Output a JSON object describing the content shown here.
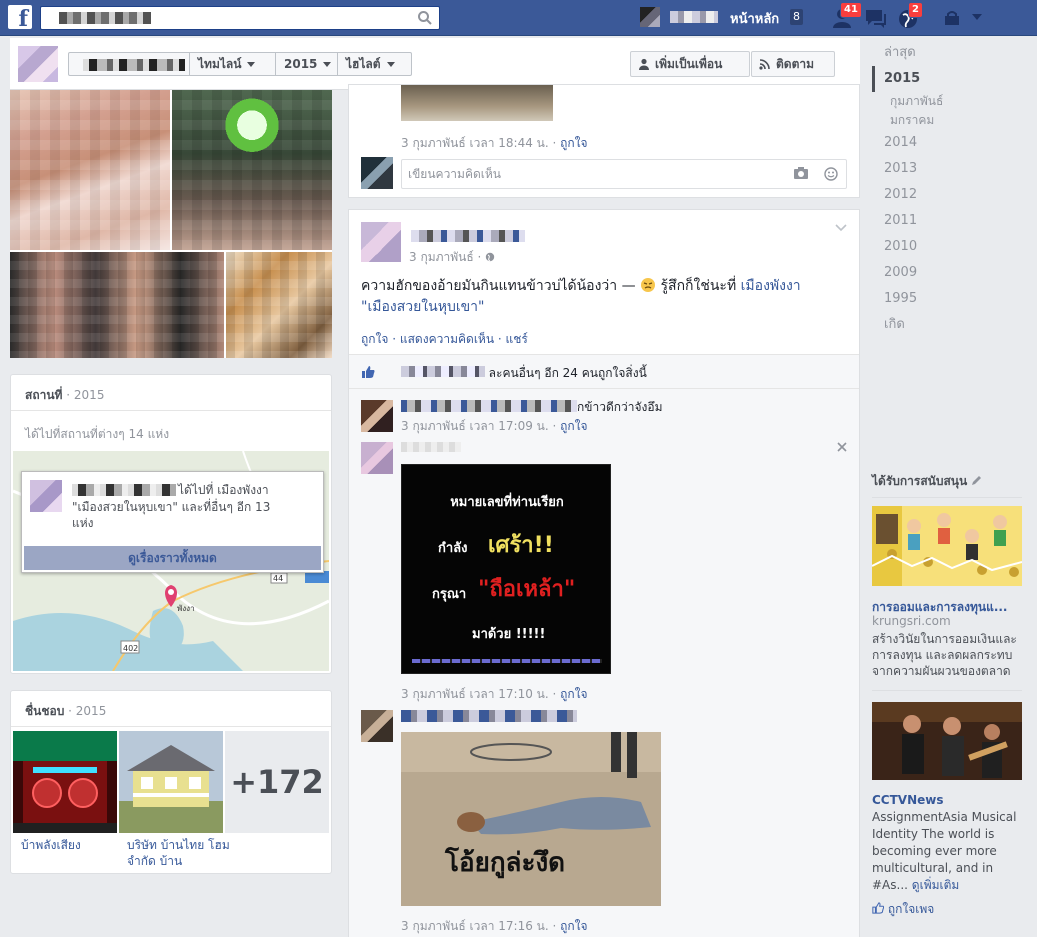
{
  "topbar": {
    "home_label": "หน้าหลัก",
    "home_count": "8",
    "friend_requests_count": "41",
    "notifications_count": "2"
  },
  "timeline_nav": {
    "timeline_label": "ไทมไลน์",
    "year_label": "2015",
    "highlights_label": "ไฮไลต์",
    "add_friend_label": "เพิ่มเป็นเพื่อน",
    "follow_label": "ติดตาม"
  },
  "places": {
    "title": "สถานที่",
    "year": "· 2015",
    "count_text": "ได้ไปที่สถานที่ต่างๆ 14 แห่ง",
    "popup_text_1": "ได้ไปที่ เมืองพังงา",
    "popup_text_2": "\"เมืองสวยในหุบเขา\" และที่อื่นๆ อีก 13",
    "popup_text_3": "แห่ง",
    "popup_button": "ดูเรื่องราวทั้งหมด",
    "map_road_1": "402",
    "map_road_2": "44",
    "map_city": "พังงา"
  },
  "likes": {
    "title": "ชื่นชอบ",
    "year": "· 2015",
    "items": [
      {
        "label": "บ้าพลังเสียง"
      },
      {
        "label": "บริษัท บ้านไทย โฮม จำกัด บ้าน"
      }
    ],
    "more_count": "+172"
  },
  "post1": {
    "time": "3 กุมภาพันธ์ เวลา 18:44 น.",
    "like": "ถูกใจ",
    "comment_placeholder": "เขียนความคิดเห็น"
  },
  "post2": {
    "date": "3 กุมภาพันธ์",
    "text_1": "ความฮักของอ้ายมันกินแทนข้าวบ่ได้น้องว่า —",
    "feeling": "รู้สึกก็ใช่นะที่",
    "place": "เมืองพังงา",
    "text_2": "\"เมืองสวยในหุบเขา\"",
    "action_like": "ถูกใจ",
    "action_comment": "แสดงความคิดเห็น",
    "action_share": "แชร์",
    "likes_text": "ละคนอื่นๆ อีก 24 คนถูกใจสิ่งนี้",
    "comments": [
      {
        "text": "กข้าวดีกว่าจังอึม",
        "time": "3 กุมภาพันธ์ เวลา 17:09 น.",
        "like": "ถูกใจ"
      },
      {
        "time": "3 กุมภาพันธ์ เวลา 17:10 น.",
        "like": "ถูกใจ"
      },
      {
        "time": "3 กุมภาพันธ์ เวลา 17:16 น.",
        "like": "ถูกใจ"
      }
    ],
    "image1": {
      "line1": "หมายเลขที่ท่านเรียก",
      "line2a": "กำลัง",
      "line2b": "เศร้า!!",
      "line3a": "กรุณา",
      "line3b": "\"ถือเหล้า\"",
      "line4": "มาด้วย !!!!!"
    },
    "image2": {
      "caption": "โอ้ยกูล่ะงึด"
    }
  },
  "years": {
    "recent": "ล่าสุด",
    "active": "2015",
    "months": [
      "กุมภาพันธ์",
      "มกราคม"
    ],
    "list": [
      "2014",
      "2013",
      "2012",
      "2011",
      "2010",
      "2009",
      "1995",
      "เกิด"
    ]
  },
  "sponsored": {
    "title": "ได้รับการสนับสนุน",
    "ad1": {
      "title": "การออมและการลงทุนแ...",
      "domain": "krungsri.com",
      "body": "สร้างวินัยในการออมเงินและการลงทุน และลดผลกระทบจากความผันผวนของตลาด"
    },
    "ad2": {
      "title": "CCTVNews",
      "body": "AssignmentAsia Musical Identity The world is becoming ever more multicultural, and in #As...",
      "more": "ดูเพิ่มเติม",
      "like_page": "ถูกใจเพจ"
    }
  }
}
